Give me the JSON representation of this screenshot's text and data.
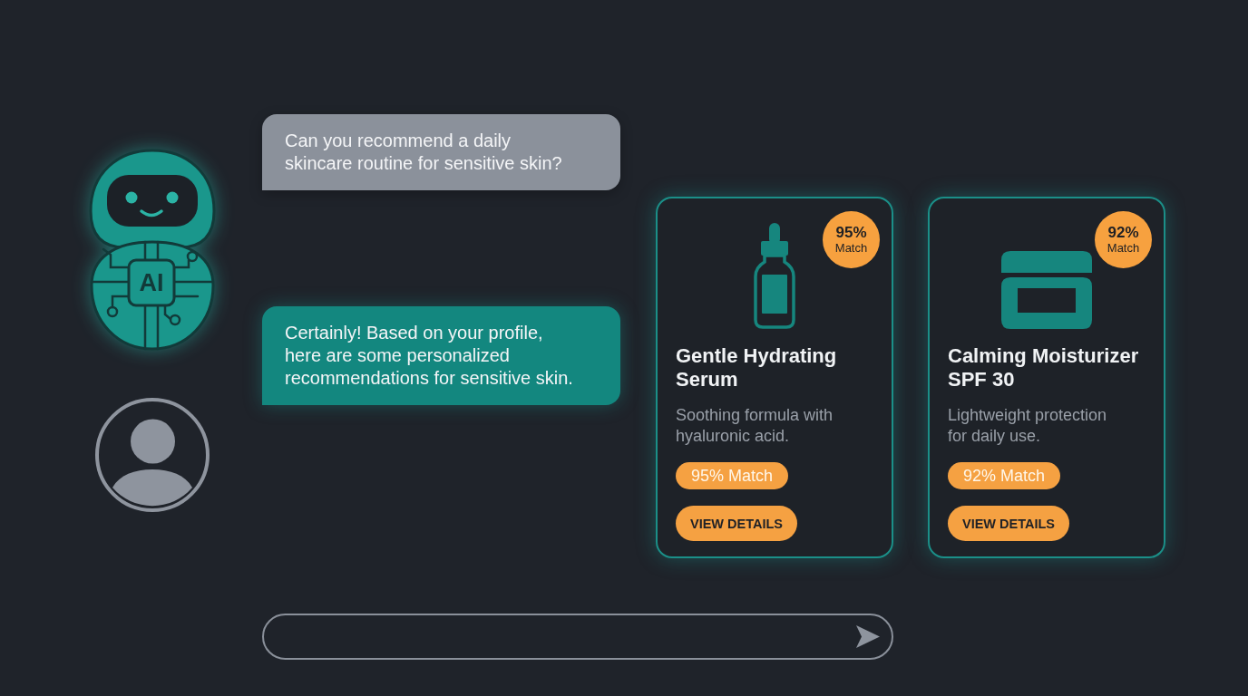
{
  "assistant_avatar": {
    "label": "AI"
  },
  "messages": [
    {
      "kind": "user",
      "lines": [
        "Can you recommend a daily",
        "skincare routine for sensitive skin?"
      ]
    },
    {
      "kind": "assistant",
      "lines": [
        "Certainly! Based on your profile,",
        "here are some personalized",
        "recommendations for sensitive skin."
      ]
    }
  ],
  "products": [
    {
      "kind": "bottle",
      "badge": {
        "percent": "95%",
        "label": "Match"
      },
      "name_lines": [
        "Gentle Hydrating",
        "Serum"
      ],
      "description_lines": [
        "Soothing formula with",
        "hyaluronic acid."
      ],
      "match_tag": "95% Match",
      "button": "VIEW DETAILS"
    },
    {
      "kind": "jar",
      "badge": {
        "percent": "92%",
        "label": "Match"
      },
      "name_lines": [
        "Calming Moisturizer",
        "SPF 30"
      ],
      "description_lines": [
        "Lightweight protection",
        "for daily use."
      ],
      "match_tag": "92% Match",
      "button": "VIEW DETAILS"
    }
  ]
}
